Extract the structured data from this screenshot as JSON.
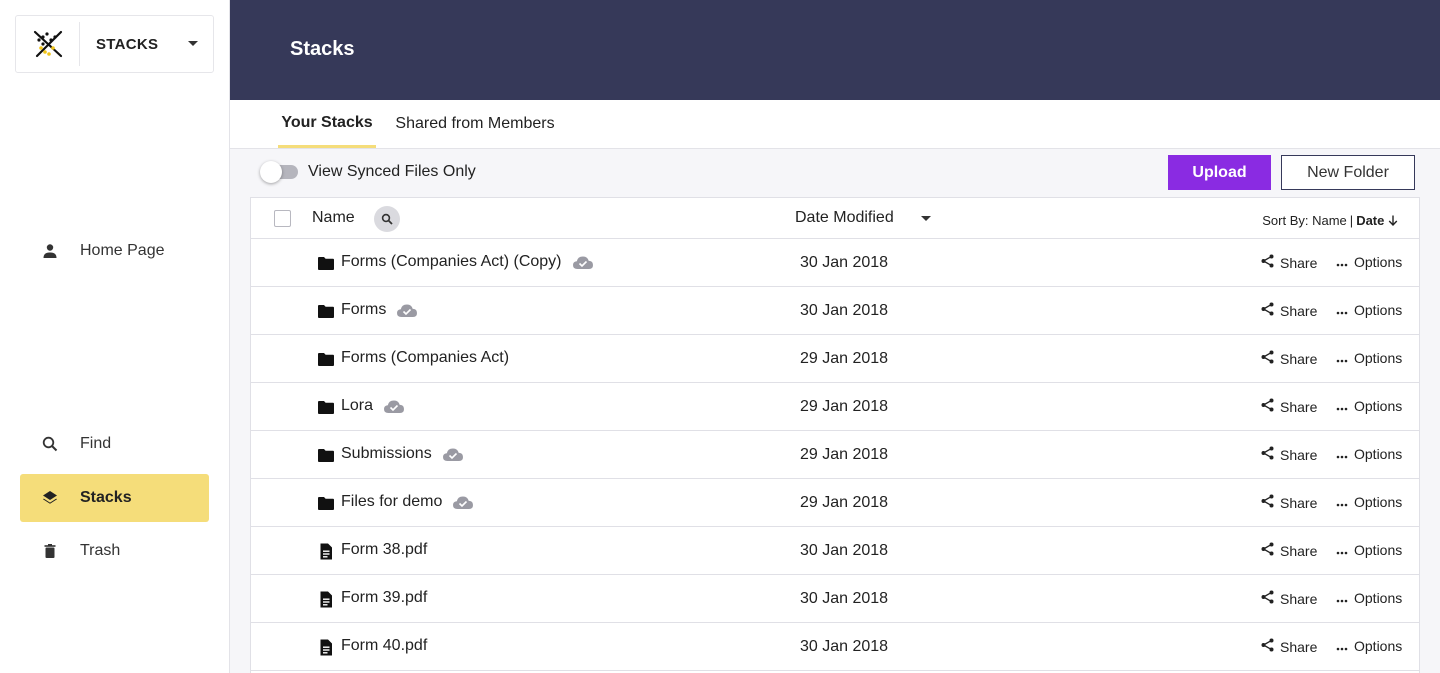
{
  "brand": {
    "name": "STACKS"
  },
  "sidebar": {
    "items": [
      {
        "label": "Home Page",
        "icon": "person-icon"
      },
      {
        "label": "Find",
        "icon": "search-icon"
      },
      {
        "label": "Stacks",
        "icon": "layers-icon",
        "active": true
      },
      {
        "label": "Trash",
        "icon": "trash-icon"
      }
    ]
  },
  "header": {
    "title": "Stacks"
  },
  "tabs": [
    {
      "label": "Your Stacks",
      "active": true
    },
    {
      "label": "Shared from Members"
    }
  ],
  "toolbar": {
    "toggle_label": "View Synced Files Only",
    "toggle_on": false,
    "upload_label": "Upload",
    "new_folder_label": "New Folder"
  },
  "table": {
    "col_name": "Name",
    "col_date": "Date Modified",
    "sort_prefix": "Sort By:",
    "sort_name": "Name",
    "sort_date": "Date",
    "share_label": "Share",
    "options_label": "Options",
    "rows": [
      {
        "name": "Forms (Companies Act) (Copy)",
        "type": "folder",
        "synced": true,
        "date": "30 Jan 2018"
      },
      {
        "name": "Forms",
        "type": "folder",
        "synced": true,
        "date": "30 Jan 2018"
      },
      {
        "name": "Forms (Companies Act)",
        "type": "folder",
        "synced": false,
        "date": "29 Jan 2018"
      },
      {
        "name": "Lora",
        "type": "folder",
        "synced": true,
        "date": "29 Jan 2018"
      },
      {
        "name": "Submissions",
        "type": "folder",
        "synced": true,
        "date": "29 Jan 2018"
      },
      {
        "name": "Files for demo",
        "type": "folder",
        "synced": true,
        "date": "29 Jan 2018"
      },
      {
        "name": "Form 38.pdf",
        "type": "file",
        "synced": false,
        "date": "30 Jan 2018"
      },
      {
        "name": "Form 39.pdf",
        "type": "file",
        "synced": false,
        "date": "30 Jan 2018"
      },
      {
        "name": "Form 40.pdf",
        "type": "file",
        "synced": false,
        "date": "30 Jan 2018"
      }
    ]
  },
  "colors": {
    "header_bg": "#363959",
    "accent_yellow": "#f5dd7a",
    "upload_purple": "#8a2be2"
  }
}
